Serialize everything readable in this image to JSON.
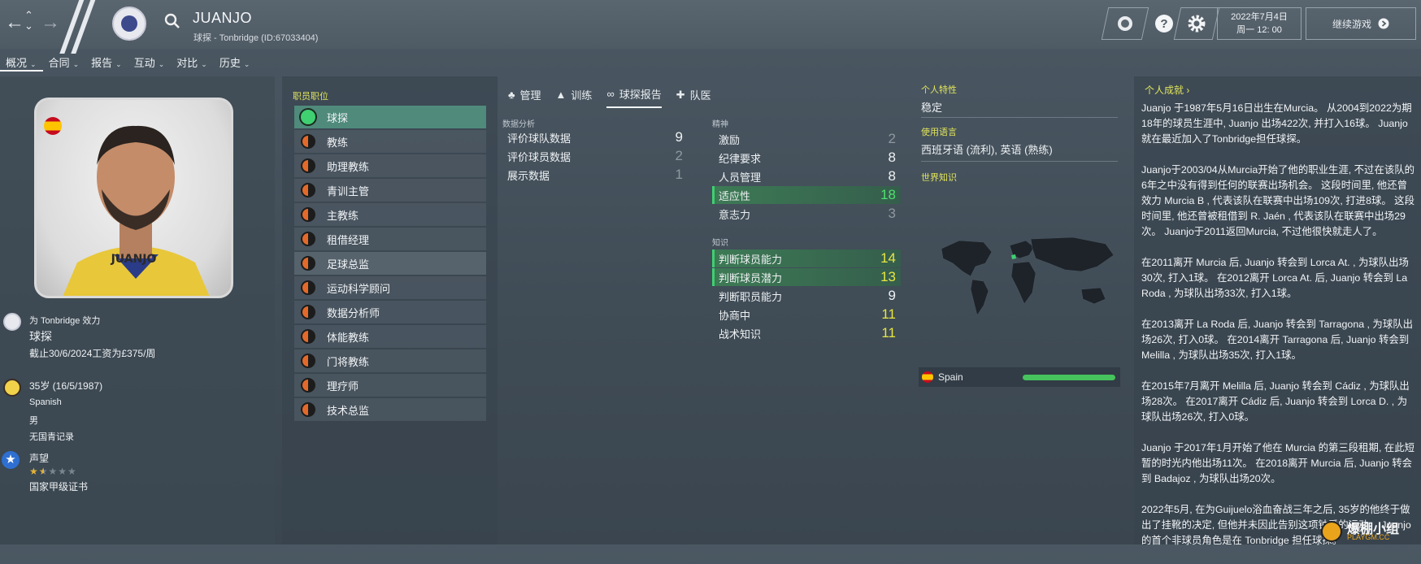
{
  "header": {
    "player_name": "JUANJO",
    "subtitle": "球探 - Tonbridge (ID:67033404)",
    "date": "2022年7月4日",
    "time": "周一 12: 00",
    "continue_label": "继续游戏",
    "help_icon": "question-icon",
    "settings_icon": "gear-icon"
  },
  "nav_tabs": [
    {
      "label": "概况"
    },
    {
      "label": "合同"
    },
    {
      "label": "报告"
    },
    {
      "label": "互动"
    },
    {
      "label": "对比"
    },
    {
      "label": "历史"
    }
  ],
  "profile": {
    "shirt_name": "JUANJO",
    "club_line": "为 Tonbridge 效力",
    "role": "球探",
    "contract": "截止30/6/2024工资为£375/周",
    "age": "35岁 (16/5/1987)",
    "nationality": "Spanish",
    "gender": "男",
    "youth": "无国青记录",
    "reputation_label": "声望",
    "reputation_stars": 1.5,
    "reputation_max": 5,
    "licence": "国家甲级证书",
    "accent_color": "#e1e45b"
  },
  "roles": {
    "title": "职员职位",
    "items": [
      {
        "label": "球探",
        "status": "green"
      },
      {
        "label": "教练",
        "status": "half"
      },
      {
        "label": "助理教练",
        "status": "half"
      },
      {
        "label": "青训主管",
        "status": "half"
      },
      {
        "label": "主教练",
        "status": "half"
      },
      {
        "label": "租借经理",
        "status": "half"
      },
      {
        "label": "足球总监",
        "status": "half"
      },
      {
        "label": "运动科学顾问",
        "status": "half"
      },
      {
        "label": "数据分析师",
        "status": "half"
      },
      {
        "label": "体能教练",
        "status": "half"
      },
      {
        "label": "门将教练",
        "status": "half"
      },
      {
        "label": "理疗师",
        "status": "half"
      },
      {
        "label": "技术总监",
        "status": "half"
      }
    ]
  },
  "sub_tabs": [
    {
      "label": "管理"
    },
    {
      "label": "训练"
    },
    {
      "label": "球探报告"
    },
    {
      "label": "队医"
    }
  ],
  "attributes": {
    "data_title": "数据分析",
    "data": [
      {
        "label": "评价球队数据",
        "value": "9"
      },
      {
        "label": "评价球员数据",
        "value": "2"
      },
      {
        "label": "展示数据",
        "value": "1"
      }
    ],
    "mental_title": "精神",
    "mental": [
      {
        "label": "激励",
        "value": "2"
      },
      {
        "label": "纪律要求",
        "value": "8"
      },
      {
        "label": "人员管理",
        "value": "8"
      },
      {
        "label": "适应性",
        "value": "18"
      },
      {
        "label": "意志力",
        "value": "3"
      }
    ],
    "knowledge_title": "知识",
    "knowledge": [
      {
        "label": "判断球员能力",
        "value": "14"
      },
      {
        "label": "判断球员潜力",
        "value": "13"
      },
      {
        "label": "判断职员能力",
        "value": "9"
      },
      {
        "label": "协商中",
        "value": "11"
      },
      {
        "label": "战术知识",
        "value": "11"
      }
    ]
  },
  "traits": {
    "personality_title": "个人特性",
    "personality": "稳定",
    "language_title": "使用语言",
    "languages": "西班牙语 (流利), 英语 (熟练)",
    "world_title": "世界知识",
    "country": "Spain",
    "country_knowledge": 1.0
  },
  "bio": {
    "title": "个人成就",
    "paragraphs": [
      "Juanjo 于1987年5月16日出生在Murcia。 从2004到2022为期18年的球员生涯中, Juanjo 出场422次, 并打入16球。 Juanjo就在最近加入了Tonbridge担任球探。",
      "Juanjo于2003/04从Murcia开始了他的职业生涯, 不过在该队的6年之中没有得到任何的联赛出场机会。 这段时间里, 他还曾效力 Murcia B , 代表该队在联赛中出场109次, 打进8球。 这段时间里, 他还曾被租借到 R. Jaén , 代表该队在联赛中出场29次。 Juanjo于2011返回Murcia, 不过他很快就走人了。",
      "在2011离开 Murcia 后, Juanjo 转会到 Lorca At. , 为球队出场30次, 打入1球。 在2012离开 Lorca At. 后, Juanjo 转会到 La Roda , 为球队出场33次, 打入1球。",
      "在2013离开 La Roda 后, Juanjo 转会到 Tarragona , 为球队出场26次, 打入0球。 在2014离开 Tarragona 后, Juanjo 转会到 Melilla , 为球队出场35次, 打入1球。",
      "在2015年7月离开 Melilla 后, Juanjo 转会到 Cádiz , 为球队出场28次。 在2017离开 Cádiz 后, Juanjo 转会到 Lorca D. , 为球队出场26次, 打入0球。",
      "Juanjo 于2017年1月开始了他在 Murcia 的第三段租期, 在此短暂的时光内他出场11次。 在2018离开 Murcia 后, Juanjo 转会到 Badajoz , 为球队出场20次。",
      "2022年5月, 在为Guijuelo浴血奋战三年之后, 35岁的他终于做出了挂靴的决定, 但他并未因此告别这项钟爱的运动。 Juanjo 的首个非球员角色是在 Tonbridge 担任球探。"
    ]
  },
  "watermark": {
    "text": "爆棚小组",
    "sub": "PLAYGM.CC"
  }
}
